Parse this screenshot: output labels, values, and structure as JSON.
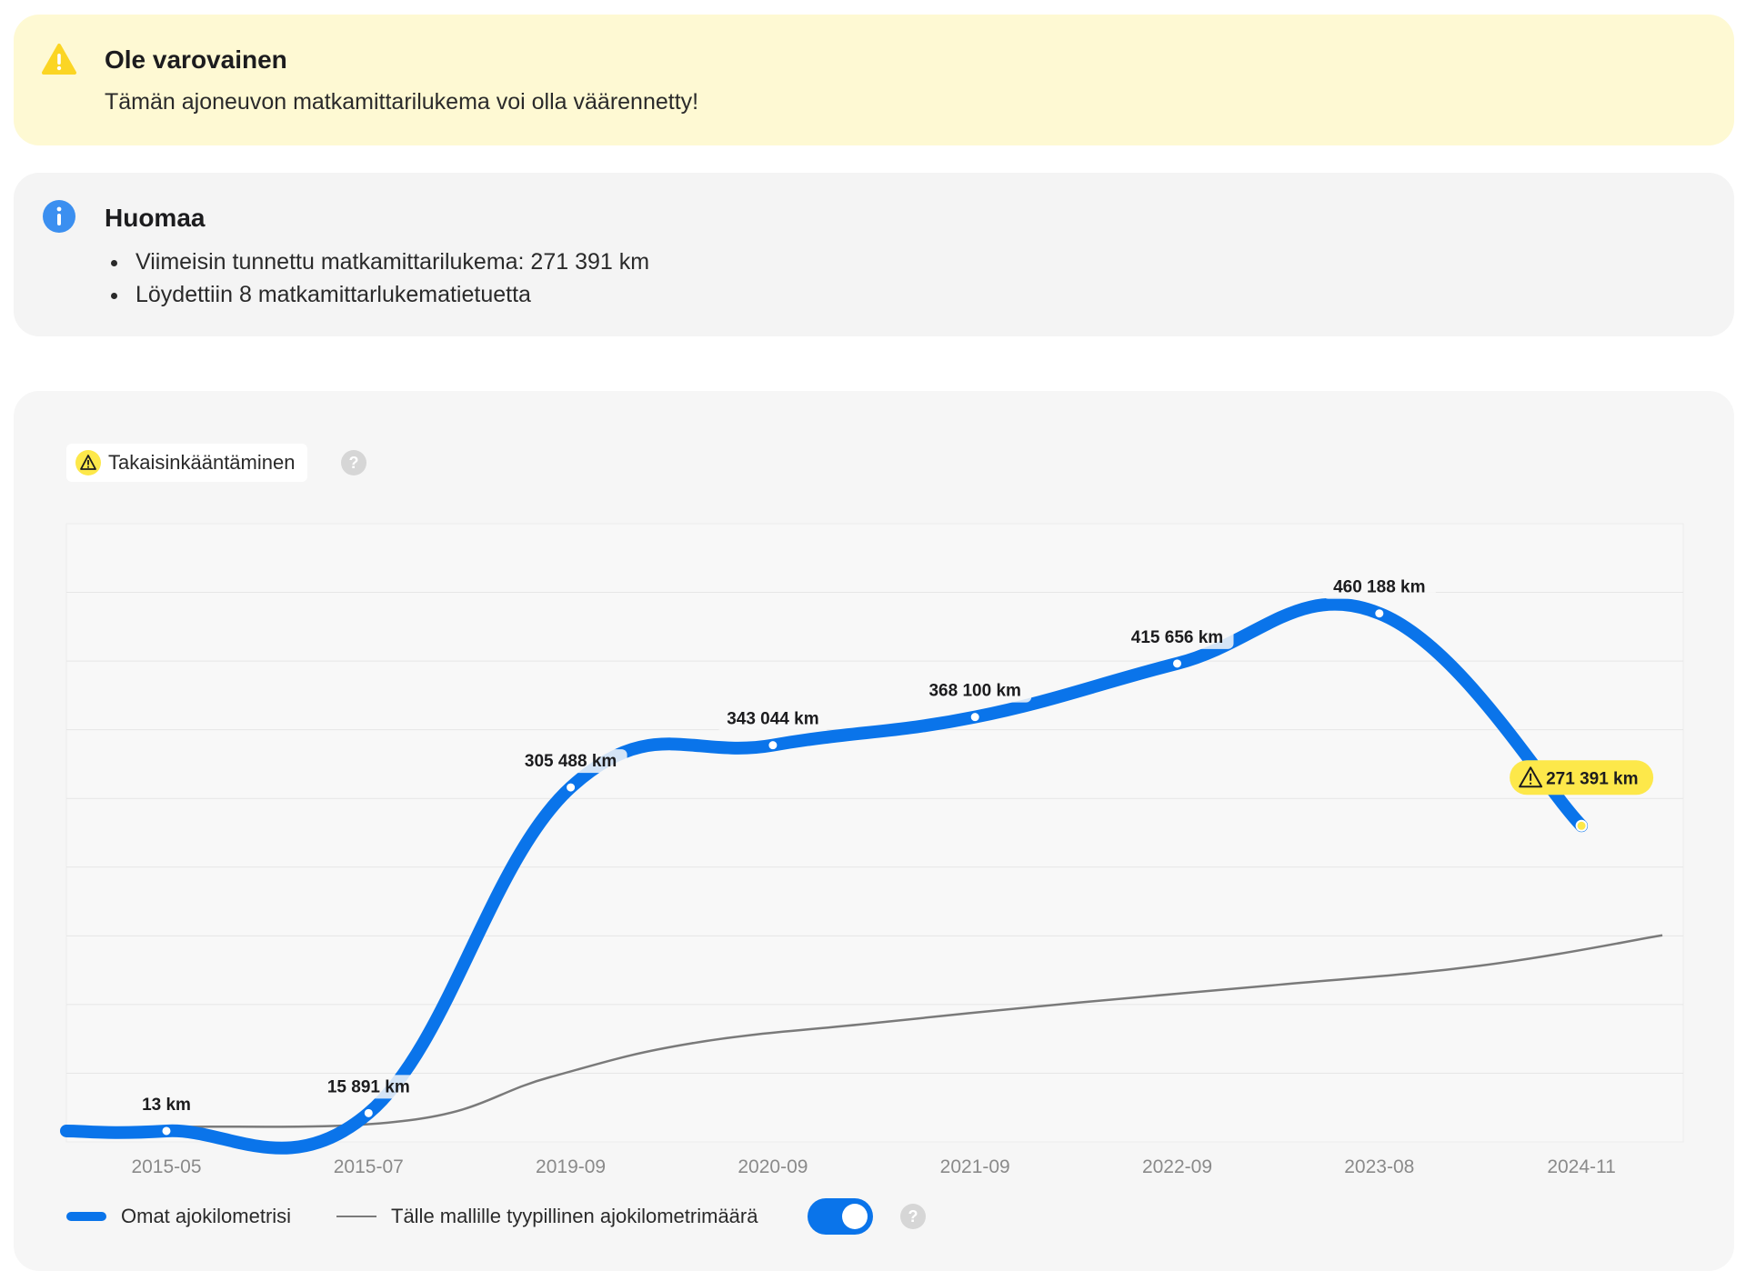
{
  "warning": {
    "title": "Ole varovainen",
    "text": "Tämän ajoneuvon matkamittarilukema voi olla väärennetty!",
    "icon": "warning-triangle-icon",
    "color": "#fbd524"
  },
  "notice": {
    "title": "Huomaa",
    "icon": "info-icon",
    "color": "#3b8ff0",
    "items": [
      "Viimeisin tunnettu matkamittarilukema: 271 391 km",
      "Löydettiin 8 matkamittarlukematietuetta"
    ]
  },
  "chart_panel": {
    "badge_label": "Takaisinkääntäminen",
    "badge_icon": "warning-triangle-icon",
    "legend": {
      "own": "Omat ajokilometrisi",
      "typical": "Tälle mallille tyypillinen ajokilometrimäärä",
      "typical_visible": true
    }
  },
  "chart_data": {
    "type": "line",
    "categories": [
      "2015-05",
      "2015-07",
      "2019-09",
      "2020-09",
      "2021-09",
      "2022-09",
      "2023-08",
      "2024-11"
    ],
    "ylim": [
      0,
      540000
    ],
    "grid": true,
    "series": [
      {
        "name": "Omat ajokilometrisi",
        "color": "#0a74ea",
        "values": [
          13,
          15891,
          305488,
          343044,
          368100,
          415656,
          460188,
          271391
        ],
        "labels": [
          "13 km",
          "15 891 km",
          "305 488 km",
          "343 044 km",
          "368 100 km",
          "415 656 km",
          "460 188 km",
          "271 391 km"
        ],
        "flagged": [
          false,
          false,
          false,
          false,
          false,
          false,
          false,
          true
        ],
        "flag_color": "#fde84a"
      },
      {
        "name": "Tälle mallille tyypillinen ajokilometrimäärä",
        "color": "#7a7a7a",
        "x": [
          -0.5,
          0,
          1.2,
          1.9,
          2.6,
          3.5,
          4.5,
          5.5,
          6.5,
          7.4
        ],
        "values": [
          1500,
          3500,
          9500,
          48000,
          78000,
          96000,
          114000,
          130000,
          147000,
          174000
        ]
      }
    ]
  }
}
